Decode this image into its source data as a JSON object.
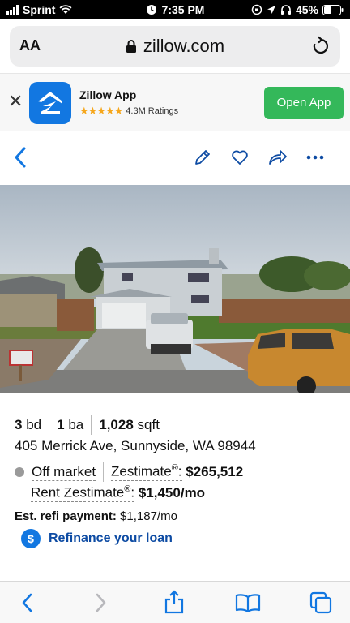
{
  "status_bar": {
    "carrier": "Sprint",
    "time": "7:35 PM",
    "battery": "45%"
  },
  "browser": {
    "text_size_label": "AA",
    "domain": "zillow.com"
  },
  "app_banner": {
    "app_name": "Zillow App",
    "stars": "★★★★★",
    "rating_count": "4.3M Ratings",
    "open_label": "Open App"
  },
  "listing": {
    "beds": "3",
    "beds_unit": "bd",
    "baths": "1",
    "baths_unit": "ba",
    "sqft": "1,028",
    "sqft_unit": "sqft",
    "address": "405 Merrick Ave, Sunnyside, WA 98944",
    "status": "Off market",
    "zestimate_label": "Zestimate",
    "zestimate_value": "$265,512",
    "rent_label": "Rent Zestimate",
    "rent_value": "$1,450/mo",
    "refi_label": "Est. refi payment:",
    "refi_value": "$1,187/mo",
    "refi_link": "Refinance your loan",
    "registered_mark": "®",
    "dollar_symbol": "$"
  },
  "colors": {
    "accent_blue": "#1277e1",
    "open_green": "#34b85a",
    "link_blue": "#0d4ba3"
  },
  "icons": [
    "wifi-icon",
    "alarm-icon",
    "location-icon",
    "headphones-icon",
    "lock-icon",
    "reload-icon",
    "close-icon",
    "zillow-logo-icon",
    "back-icon",
    "edit-icon",
    "heart-icon",
    "share-icon",
    "more-icon",
    "forward-icon",
    "bookmarks-icon",
    "tabs-icon",
    "dollar-icon"
  ]
}
